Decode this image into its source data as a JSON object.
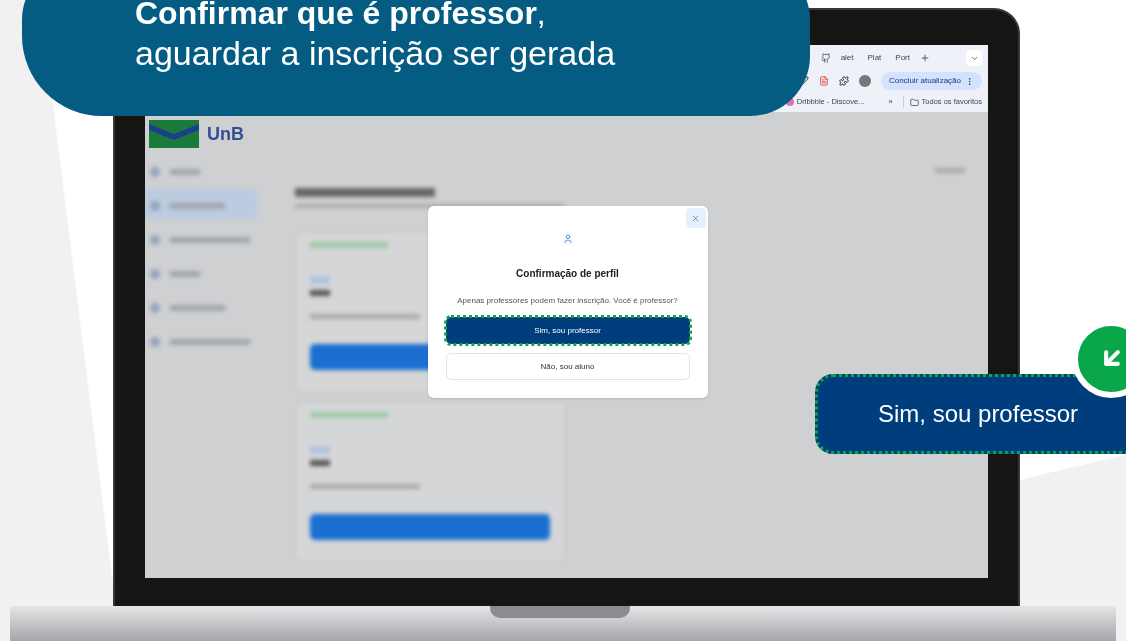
{
  "banner": {
    "title_bold": "Confirmar que é professor",
    "title_rest": ",",
    "subtitle": "aguardar a inscrição ser gerada"
  },
  "browser": {
    "tabs": [
      {
        "label": "alet",
        "selected": false
      },
      {
        "label": "Plat",
        "selected": false
      },
      {
        "label": "Port",
        "selected": false
      }
    ],
    "update_button": "Concluir atualização",
    "bookmark": "Dribbble - Discove...",
    "overflow": "»",
    "all_bookmarks": "Todos os favoritos"
  },
  "app": {
    "logo": "UnB"
  },
  "modal": {
    "title": "Confirmação de perfil",
    "message": "Apenas professores podem fazer inscrição. Você é professor?",
    "buttons": [
      {
        "label": "Sim, sou professor",
        "kind": "primary",
        "highlighted": true
      },
      {
        "label": "Não, sou aluno",
        "kind": "secondary",
        "highlighted": false
      }
    ]
  },
  "callout": {
    "label": "Sim, sou professor"
  }
}
